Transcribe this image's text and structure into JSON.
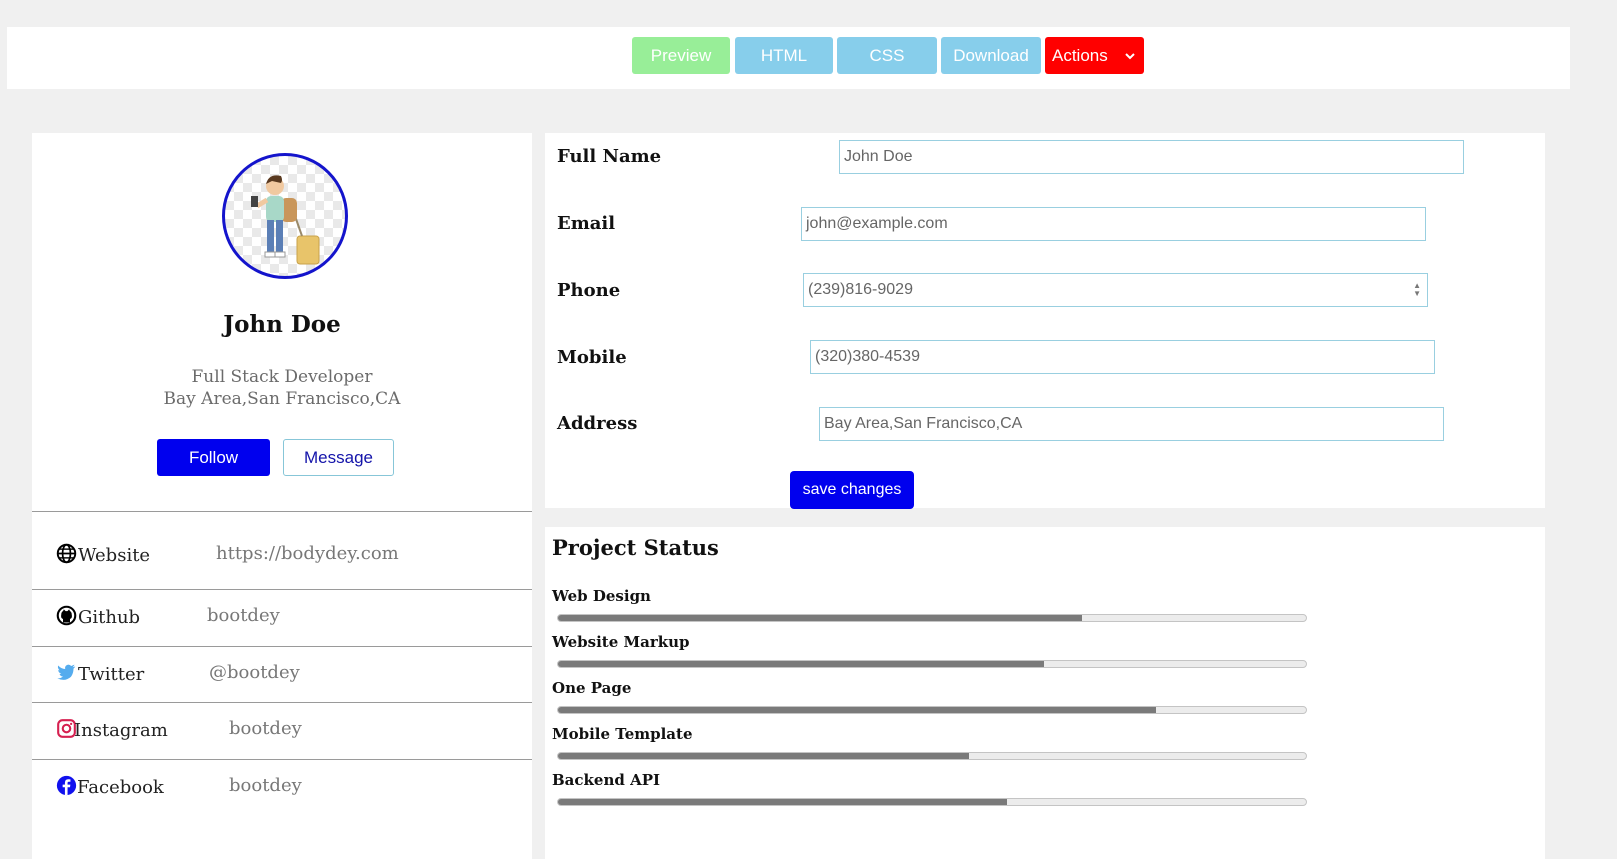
{
  "toolbar": {
    "buttons": [
      {
        "label": "Preview",
        "color": "#98ee98"
      },
      {
        "label": "HTML",
        "color": "#87ceeb"
      },
      {
        "label": "CSS",
        "color": "#87ceeb"
      },
      {
        "label": "Download",
        "color": "#87ceeb"
      },
      {
        "label": "Actions",
        "color": "#ff0000"
      }
    ]
  },
  "profile": {
    "name": "John Doe",
    "title": "Full Stack Developer",
    "location": "Bay Area,San Francisco,CA",
    "follow_label": "Follow",
    "message_label": "Message",
    "accent": "#0000ee"
  },
  "social": [
    {
      "label": "Website",
      "value": "https://bodydey.com",
      "icon": "globe-icon"
    },
    {
      "label": "Github",
      "value": "bootdey",
      "icon": "github-icon"
    },
    {
      "label": "Twitter",
      "value": "@bootdey",
      "icon": "twitter-icon"
    },
    {
      "label": "Instagram",
      "value": "bootdey",
      "icon": "instagram-icon"
    },
    {
      "label": "Facebook",
      "value": "bootdey",
      "icon": "facebook-icon"
    }
  ],
  "form": {
    "fields": [
      {
        "label": "Full Name",
        "value": "John Doe"
      },
      {
        "label": "Email",
        "value": "john@example.com"
      },
      {
        "label": "Phone",
        "value": "(239)816-9029"
      },
      {
        "label": "Mobile",
        "value": "(320)380-4539"
      },
      {
        "label": "Address",
        "value": "Bay Area,San Francisco,CA"
      }
    ],
    "save_label": "save changes"
  },
  "projects": {
    "title": "Project Status",
    "items": [
      {
        "label": "Web Design",
        "progress": 0.7
      },
      {
        "label": "Website Markup",
        "progress": 0.65
      },
      {
        "label": "One Page",
        "progress": 0.8
      },
      {
        "label": "Mobile Template",
        "progress": 0.55
      },
      {
        "label": "Backend API",
        "progress": 0.6
      }
    ]
  }
}
